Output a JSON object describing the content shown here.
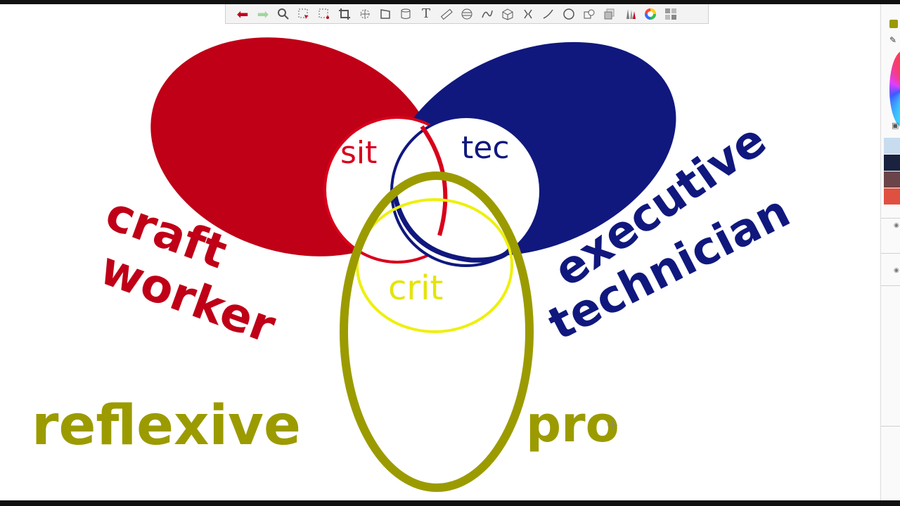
{
  "toolbar": {
    "tools": [
      {
        "name": "undo-arrow-icon"
      },
      {
        "name": "redo-arrow-icon"
      },
      {
        "name": "zoom-magnifier-icon"
      },
      {
        "name": "selection-tool-icon"
      },
      {
        "name": "lasso-selection-icon"
      },
      {
        "name": "crop-icon"
      },
      {
        "name": "transform-icon"
      },
      {
        "name": "perspective-icon"
      },
      {
        "name": "layer-cylinder-icon"
      },
      {
        "name": "text-tool-icon",
        "label": "T"
      },
      {
        "name": "ruler-icon"
      },
      {
        "name": "ellipse-guide-icon"
      },
      {
        "name": "curve-guide-icon"
      },
      {
        "name": "grid-perspective-icon"
      },
      {
        "name": "symmetry-icon"
      },
      {
        "name": "stroke-tool-icon"
      },
      {
        "name": "shape-circle-icon"
      },
      {
        "name": "copy-shapes-icon"
      },
      {
        "name": "layers-stack-icon"
      },
      {
        "name": "brush-library-icon"
      },
      {
        "name": "color-wheel-icon"
      },
      {
        "name": "palette-grid-icon"
      }
    ]
  },
  "canvas": {
    "colors": {
      "red": "#bf0017",
      "navy": "#10187e",
      "olive": "#9b9b00",
      "yellow": "#eef00c",
      "white": "#ffffff"
    },
    "labels": {
      "sit": "sit",
      "tec": "tec",
      "crit": "crit",
      "craft": "craft",
      "worker": "worker",
      "executive": "executive",
      "technician": "technician",
      "reflexive": "reflexive",
      "pro": "pro"
    }
  },
  "right_panel": {
    "brush_color": "#9a9a05",
    "swatches": [
      "#c8dcf0",
      "#1a2240",
      "#6a4448",
      "#e05040"
    ]
  }
}
